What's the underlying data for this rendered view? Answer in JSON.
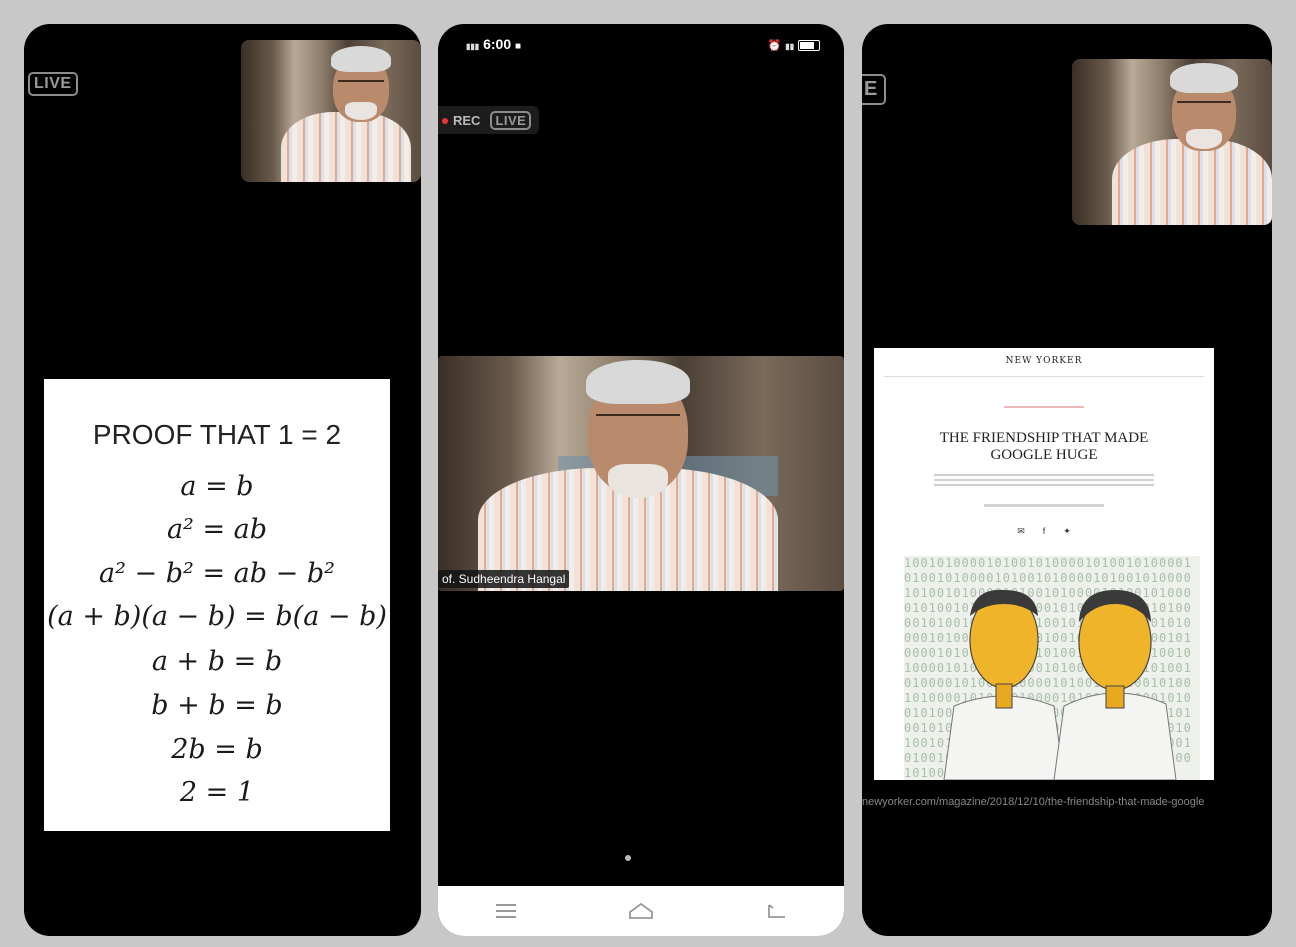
{
  "panel1": {
    "live_badge": "LIVE",
    "proof": {
      "title": "PROOF THAT 1 = 2",
      "steps": [
        "a = b",
        "a² = ab",
        "a² − b² = ab − b²",
        "(a + b)(a − b) = b(a − b)",
        "a + b = b",
        "b + b = b",
        "2b = b",
        "2 = 1"
      ]
    }
  },
  "panel2": {
    "status_bar": {
      "time": "6:00"
    },
    "rec_label": "REC",
    "live_badge": "LIVE",
    "speaker_name": "of. Sudheendra Hangal",
    "nav": {
      "menu_icon": "menu-icon",
      "home_icon": "home-icon",
      "back_icon": "back-icon"
    }
  },
  "panel3": {
    "live_badge": "E",
    "article": {
      "logo": "NEW YORKER",
      "title": "THE FRIENDSHIP THAT MADE GOOGLE HUGE",
      "share_icons": [
        "mail-icon",
        "facebook-icon",
        "twitter-icon"
      ]
    },
    "url": "newyorker.com/magazine/2018/12/10/the-friendship-that-made-google"
  }
}
